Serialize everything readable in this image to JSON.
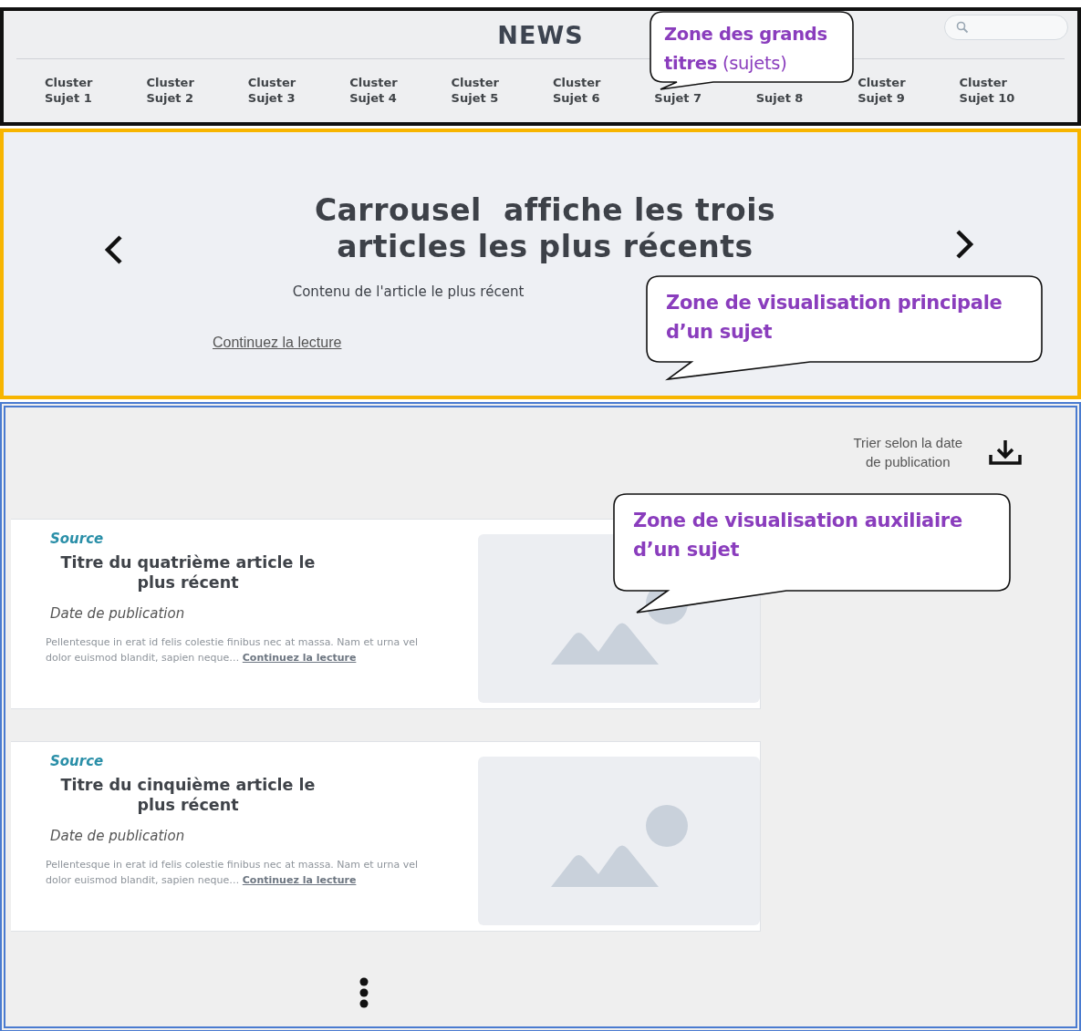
{
  "header": {
    "title": "NEWS"
  },
  "tabs": [
    {
      "lines": [
        "Cluster",
        "Sujet 1"
      ]
    },
    {
      "lines": [
        "Cluster",
        "Sujet 2"
      ]
    },
    {
      "lines": [
        "Cluster",
        "Sujet 3"
      ]
    },
    {
      "lines": [
        "Cluster",
        "Sujet 4"
      ]
    },
    {
      "lines": [
        "Cluster",
        "Sujet 5"
      ]
    },
    {
      "lines": [
        "Cluster",
        "Sujet 6"
      ]
    },
    {
      "lines": [
        "Sujet 7"
      ]
    },
    {
      "lines": [
        "Sujet 8"
      ]
    },
    {
      "lines": [
        "Cluster",
        "Sujet 9"
      ]
    },
    {
      "lines": [
        "Cluster",
        "Sujet 10"
      ]
    }
  ],
  "carousel": {
    "title_lines": [
      "Carrousel  affiche les trois",
      "articles les plus récents"
    ],
    "excerpt": "Contenu de l'article le plus récent",
    "link": "Continuez la lecture"
  },
  "sort": {
    "label_lines": [
      "Trier selon la date",
      "de publication"
    ]
  },
  "articles": [
    {
      "source": "Source",
      "title_lines": [
        "Titre du quatrième article le",
        "plus récent"
      ],
      "date": "Date de publication",
      "excerpt": "Pellentesque in erat id felis colestie finibus nec at massa. Nam et urna vel dolor euismod blandit, sapien neque… ",
      "link": "Continuez la lecture"
    },
    {
      "source": "Source",
      "title_lines": [
        "Titre du cinquième article le",
        "plus récent"
      ],
      "date": "Date de publication",
      "excerpt": "Pellentesque in erat id felis colestie finibus nec at massa. Nam et urna vel dolor euismod blandit, sapien neque… ",
      "link": "Continuez la lecture"
    }
  ],
  "callouts": [
    {
      "text": "**Zone des grands titres** (sujets)"
    },
    {
      "text": "Zone de visualisation principale d’un sujet"
    },
    {
      "text": "Zone de visualisation auxiliaire d’un sujet"
    }
  ]
}
